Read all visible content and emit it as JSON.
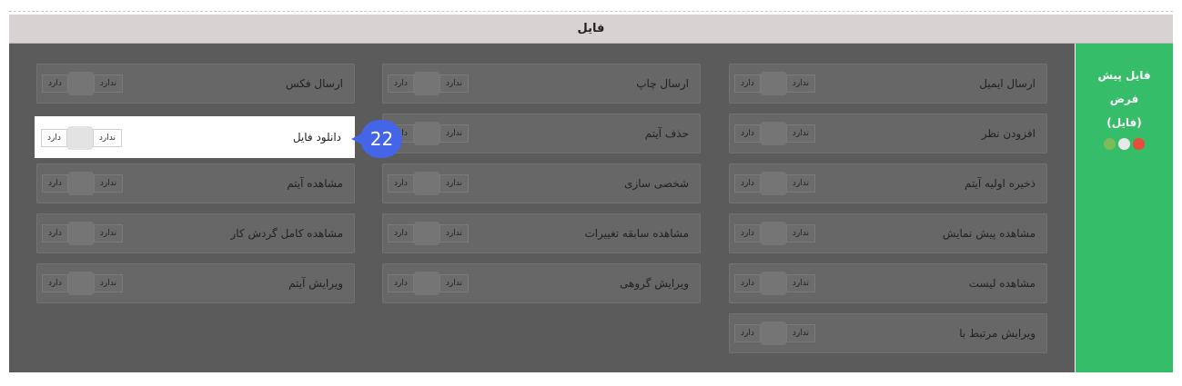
{
  "header": {
    "title": "فایل"
  },
  "side_panel": {
    "line1": "فایل پیش",
    "line2": "فرض",
    "line3": "(فایل)",
    "dot_colors": [
      "#e74c3c",
      "#e8e8e8",
      "#7dbb57"
    ]
  },
  "toggle": {
    "yes": "دارد",
    "no": "ندارد"
  },
  "permissions": {
    "col1": [
      "ارسال ایمیل",
      "افزودن نظر",
      "ذخیره اولیه آیتم",
      "مشاهده پیش نمایش",
      "مشاهده لیست",
      "ویرایش مرتبط با"
    ],
    "col2": [
      "ارسال چاپ",
      "حذف آیتم",
      "شخصی سازی",
      "مشاهده سابقه تغییرات",
      "ویرایش گروهی"
    ],
    "col3": [
      "ارسال فکس",
      "دانلود فایل",
      "مشاهده آیتم",
      "مشاهده کامل گردش کار",
      "ویرایش آیتم"
    ]
  },
  "callout": {
    "number": "22"
  },
  "colors": {
    "accent_green": "#36bd6a",
    "callout_blue": "#4565e8"
  }
}
